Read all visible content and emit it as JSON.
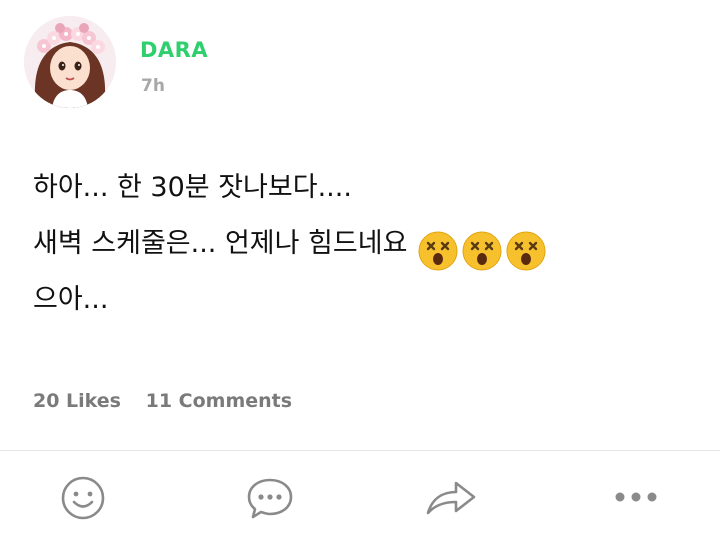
{
  "post": {
    "author": "DARA",
    "time": "7h",
    "text_lines": [
      "하아... 한 30분 잣나보다....",
      "새벽 스케줄은... 언제나 힘드네요",
      "으아..."
    ],
    "emoji": [
      "dizzy-face-emoji",
      "dizzy-face-emoji",
      "dizzy-face-emoji"
    ],
    "likes": "20 Likes",
    "comments": "11 Comments"
  },
  "actions": {
    "icons": [
      "smiley-icon",
      "comment-icon",
      "share-icon",
      "more-icon"
    ]
  },
  "colors": {
    "author": "#2fcf6e",
    "meta": "#a8a8a8",
    "stats": "#7a7a7a",
    "icons": "#8a8a8a"
  }
}
